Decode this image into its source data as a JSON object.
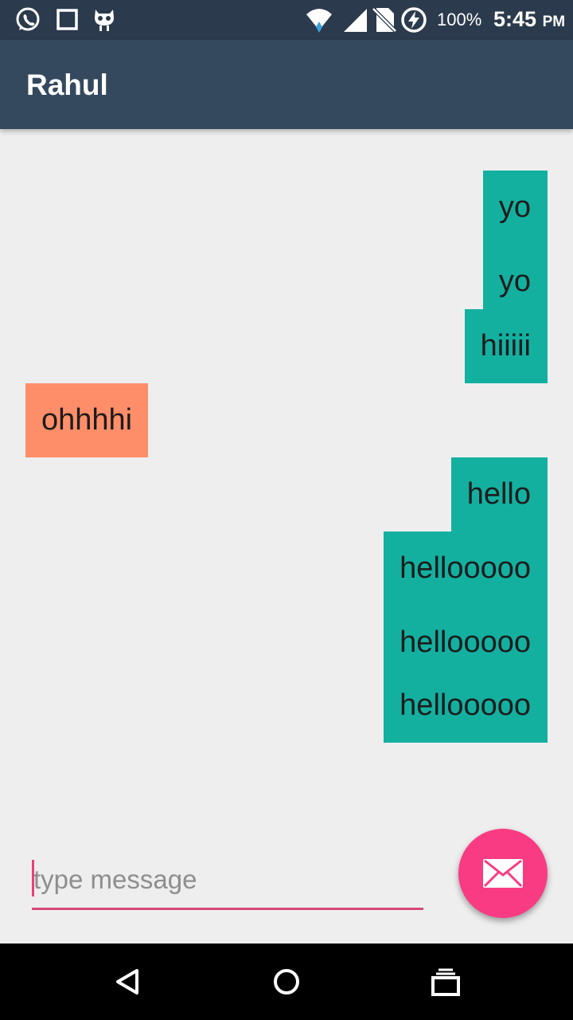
{
  "status_bar": {
    "icons": [
      "whatsapp-icon",
      "square-notification-icon",
      "cyanogenmod-icon",
      "wifi-icon",
      "signal-icon",
      "no-sim-icon",
      "battery-charging-icon"
    ],
    "battery": "100%",
    "time": "5:45",
    "ampm": "PM"
  },
  "app_bar": {
    "title": "Rahul"
  },
  "messages": [
    {
      "text": "yo",
      "direction": "sent"
    },
    {
      "text": "yo",
      "direction": "sent"
    },
    {
      "text": "hiiiii",
      "direction": "sent"
    },
    {
      "text": "ohhhhi",
      "direction": "received"
    },
    {
      "text": "hello",
      "direction": "sent"
    },
    {
      "text": "hellooooo",
      "direction": "sent"
    },
    {
      "text": "hellooooo",
      "direction": "sent"
    },
    {
      "text": "hellooooo",
      "direction": "sent"
    }
  ],
  "composer": {
    "placeholder": "type message",
    "value": "",
    "send_icon": "envelope-icon"
  },
  "nav_bar": {
    "buttons": [
      "back-icon",
      "home-icon",
      "recents-icon"
    ]
  },
  "colors": {
    "status_bar": "#2b3a4c",
    "app_bar": "#34495e",
    "sent_bubble": "#13b0a0",
    "received_bubble": "#fe8e69",
    "fab": "#f83b83",
    "background": "#eeeeee"
  }
}
